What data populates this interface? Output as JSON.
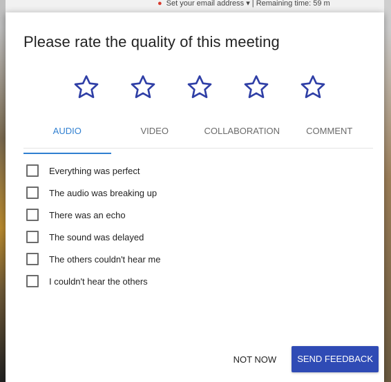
{
  "background": {
    "header_text": "Set your email address ▾  |  Remaining time: 59 m"
  },
  "dialog": {
    "title": "Please rate the quality of this meeting",
    "rating": {
      "max": 5,
      "value": 0,
      "star_color": "#2f3fa6",
      "icon": "star-outline-icon"
    },
    "tabs": [
      {
        "label": "AUDIO",
        "active": true
      },
      {
        "label": "VIDEO",
        "active": false
      },
      {
        "label": "COLLABORATION",
        "active": false
      },
      {
        "label": "COMMENT",
        "active": false
      }
    ],
    "options": [
      {
        "label": "Everything was perfect",
        "checked": false
      },
      {
        "label": "The audio was breaking up",
        "checked": false
      },
      {
        "label": "There was an echo",
        "checked": false
      },
      {
        "label": "The sound was delayed",
        "checked": false
      },
      {
        "label": "The others couldn't hear me",
        "checked": false
      },
      {
        "label": "I couldn't hear the others",
        "checked": false
      }
    ],
    "actions": {
      "secondary_label": "NOT NOW",
      "primary_label": "SEND FEEDBACK"
    }
  },
  "colors": {
    "accent_blue": "#2f7fd0",
    "primary_button": "#2f4bb5",
    "star_outline": "#2f3fa6"
  }
}
